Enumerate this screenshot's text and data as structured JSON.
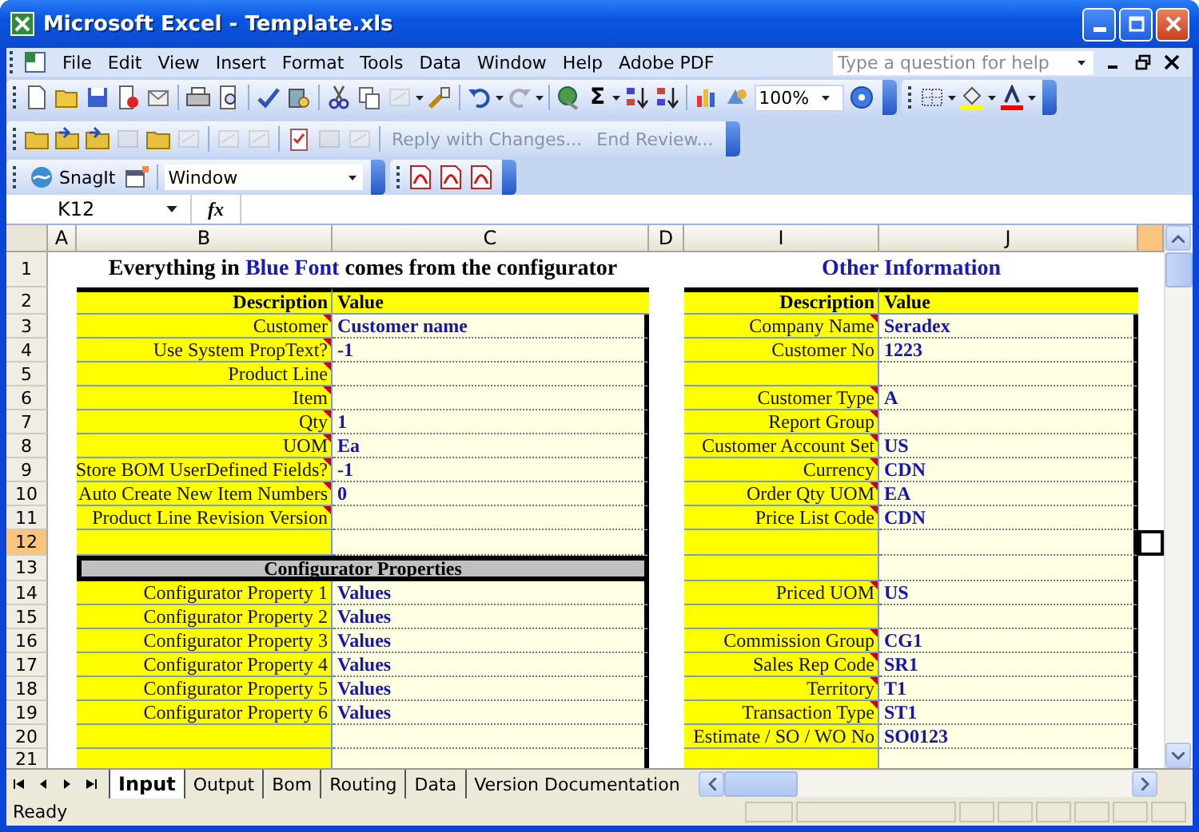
{
  "window": {
    "title": "Microsoft Excel - Template.xls"
  },
  "menu_bar": {
    "items": [
      "File",
      "Edit",
      "View",
      "Insert",
      "Format",
      "Tools",
      "Data",
      "Window",
      "Help",
      "Adobe PDF"
    ],
    "help_placeholder": "Type a question for help"
  },
  "standard_toolbar": {
    "autosum": "Σ",
    "zoom": "100%"
  },
  "reviewing_toolbar": {
    "buttons": [
      {
        "label": "Reply with Changes...",
        "disabled": true
      },
      {
        "label": "End Review...",
        "disabled": true
      }
    ]
  },
  "snagit_toolbar": {
    "label": "SnagIt",
    "capture_mode": "Window"
  },
  "formula_bar": {
    "name_box": "K12",
    "function_label": "fx"
  },
  "columns": [
    {
      "label": "A",
      "selected": false
    },
    {
      "label": "B",
      "selected": false
    },
    {
      "label": "C",
      "selected": false
    },
    {
      "label": "D",
      "selected": false
    },
    {
      "label": "I",
      "selected": false
    },
    {
      "label": "J",
      "selected": false
    }
  ],
  "partial_column": {
    "selected": true
  },
  "rows": [
    {
      "number": "1",
      "selected": false,
      "left": {
        "kind": "title",
        "parts": [
          {
            "text": "Everything in ",
            "blue": false
          },
          {
            "text": "Blue Font",
            "blue": true
          },
          {
            "text": " comes from the configurator",
            "blue": false
          }
        ]
      },
      "right": {
        "kind": "title",
        "parts": [
          {
            "text": "Other Information",
            "blue": true
          }
        ]
      }
    },
    {
      "number": "2",
      "selected": false,
      "left": {
        "kind": "header",
        "label": "Description",
        "value": "Value"
      },
      "right": {
        "kind": "header",
        "label": "Description",
        "value": "Value"
      }
    },
    {
      "number": "3",
      "selected": false,
      "left": {
        "kind": "item",
        "label": "Customer",
        "value": "Customer name",
        "comment": true
      },
      "right": {
        "kind": "item",
        "label": "Company Name",
        "value": "Seradex",
        "comment": true
      }
    },
    {
      "number": "4",
      "selected": false,
      "left": {
        "kind": "item",
        "label": "Use System PropText?",
        "value": "-1",
        "comment": true
      },
      "right": {
        "kind": "item",
        "label": "Customer No",
        "value": "1223",
        "comment": false
      }
    },
    {
      "number": "5",
      "selected": false,
      "left": {
        "kind": "item",
        "label": "Product Line",
        "comment": true
      },
      "right": {
        "kind": "blank"
      }
    },
    {
      "number": "6",
      "selected": false,
      "left": {
        "kind": "item",
        "label": "Item",
        "comment": true
      },
      "right": {
        "kind": "item",
        "label": "Customer Type",
        "value": "A",
        "comment": true
      }
    },
    {
      "number": "7",
      "selected": false,
      "left": {
        "kind": "item",
        "label": "Qty",
        "value": "1",
        "comment": true
      },
      "right": {
        "kind": "item",
        "label": "Report Group",
        "comment": true
      }
    },
    {
      "number": "8",
      "selected": false,
      "left": {
        "kind": "item",
        "label": "UOM",
        "value": "Ea",
        "comment": true
      },
      "right": {
        "kind": "item",
        "label": "Customer Account Set",
        "value": "US",
        "comment": true
      }
    },
    {
      "number": "9",
      "selected": false,
      "left": {
        "kind": "item",
        "label": "Store BOM UserDefined Fields?",
        "value": "-1",
        "comment": true
      },
      "right": {
        "kind": "item",
        "label": "Currency",
        "value": "CDN",
        "comment": true
      }
    },
    {
      "number": "10",
      "selected": false,
      "left": {
        "kind": "item",
        "label": "Auto Create New Item Numbers",
        "value": "0",
        "comment": true
      },
      "right": {
        "kind": "item",
        "label": "Order Qty UOM",
        "value": "EA",
        "comment": true
      }
    },
    {
      "number": "11",
      "selected": false,
      "left": {
        "kind": "item",
        "label": "Product Line Revision Version",
        "comment": true
      },
      "right": {
        "kind": "item",
        "label": "Price List Code",
        "value": "CDN",
        "comment": true
      }
    },
    {
      "number": "12",
      "selected": true,
      "left": {
        "kind": "blank"
      },
      "right": {
        "kind": "blank"
      }
    },
    {
      "number": "13",
      "selected": false,
      "left": {
        "kind": "section",
        "label": "Configurator Properties"
      },
      "right": {
        "kind": "blank"
      }
    },
    {
      "number": "14",
      "selected": false,
      "left": {
        "kind": "item",
        "label": "Configurator Property 1",
        "value": "Values",
        "comment": false
      },
      "right": {
        "kind": "item",
        "label": "Priced UOM",
        "value": "US",
        "comment": true
      }
    },
    {
      "number": "15",
      "selected": false,
      "left": {
        "kind": "item",
        "label": "Configurator Property 2",
        "value": "Values",
        "comment": false
      },
      "right": {
        "kind": "blank"
      }
    },
    {
      "number": "16",
      "selected": false,
      "left": {
        "kind": "item",
        "label": "Configurator Property 3",
        "value": "Values",
        "comment": false
      },
      "right": {
        "kind": "item",
        "label": "Commission Group",
        "value": "CG1",
        "comment": true
      }
    },
    {
      "number": "17",
      "selected": false,
      "left": {
        "kind": "item",
        "label": "Configurator Property 4",
        "value": "Values",
        "comment": false
      },
      "right": {
        "kind": "item",
        "label": "Sales Rep Code",
        "value": "SR1",
        "comment": true
      }
    },
    {
      "number": "18",
      "selected": false,
      "left": {
        "kind": "item",
        "label": "Configurator Property 5",
        "value": "Values",
        "comment": false
      },
      "right": {
        "kind": "item",
        "label": "Territory",
        "value": "T1",
        "comment": true
      }
    },
    {
      "number": "19",
      "selected": false,
      "left": {
        "kind": "item",
        "label": "Configurator Property 6",
        "value": "Values",
        "comment": false
      },
      "right": {
        "kind": "item",
        "label": "Transaction Type",
        "value": "ST1",
        "comment": true
      }
    },
    {
      "number": "20",
      "selected": false,
      "left": {
        "kind": "blank"
      },
      "right": {
        "kind": "item",
        "label": "Estimate / SO / WO No",
        "value": "SO0123",
        "comment": false
      }
    },
    {
      "number": "21",
      "selected": false,
      "left": {
        "kind": "blank"
      },
      "right": {
        "kind": "blank"
      }
    }
  ],
  "sheet_tabs": [
    {
      "label": "Input",
      "selected": true
    },
    {
      "label": "Output",
      "selected": false
    },
    {
      "label": "Bom",
      "selected": false
    },
    {
      "label": "Routing",
      "selected": false
    },
    {
      "label": "Data",
      "selected": false
    },
    {
      "label": "Version Documentation",
      "selected": false
    }
  ],
  "status_bar": {
    "text": "Ready"
  }
}
